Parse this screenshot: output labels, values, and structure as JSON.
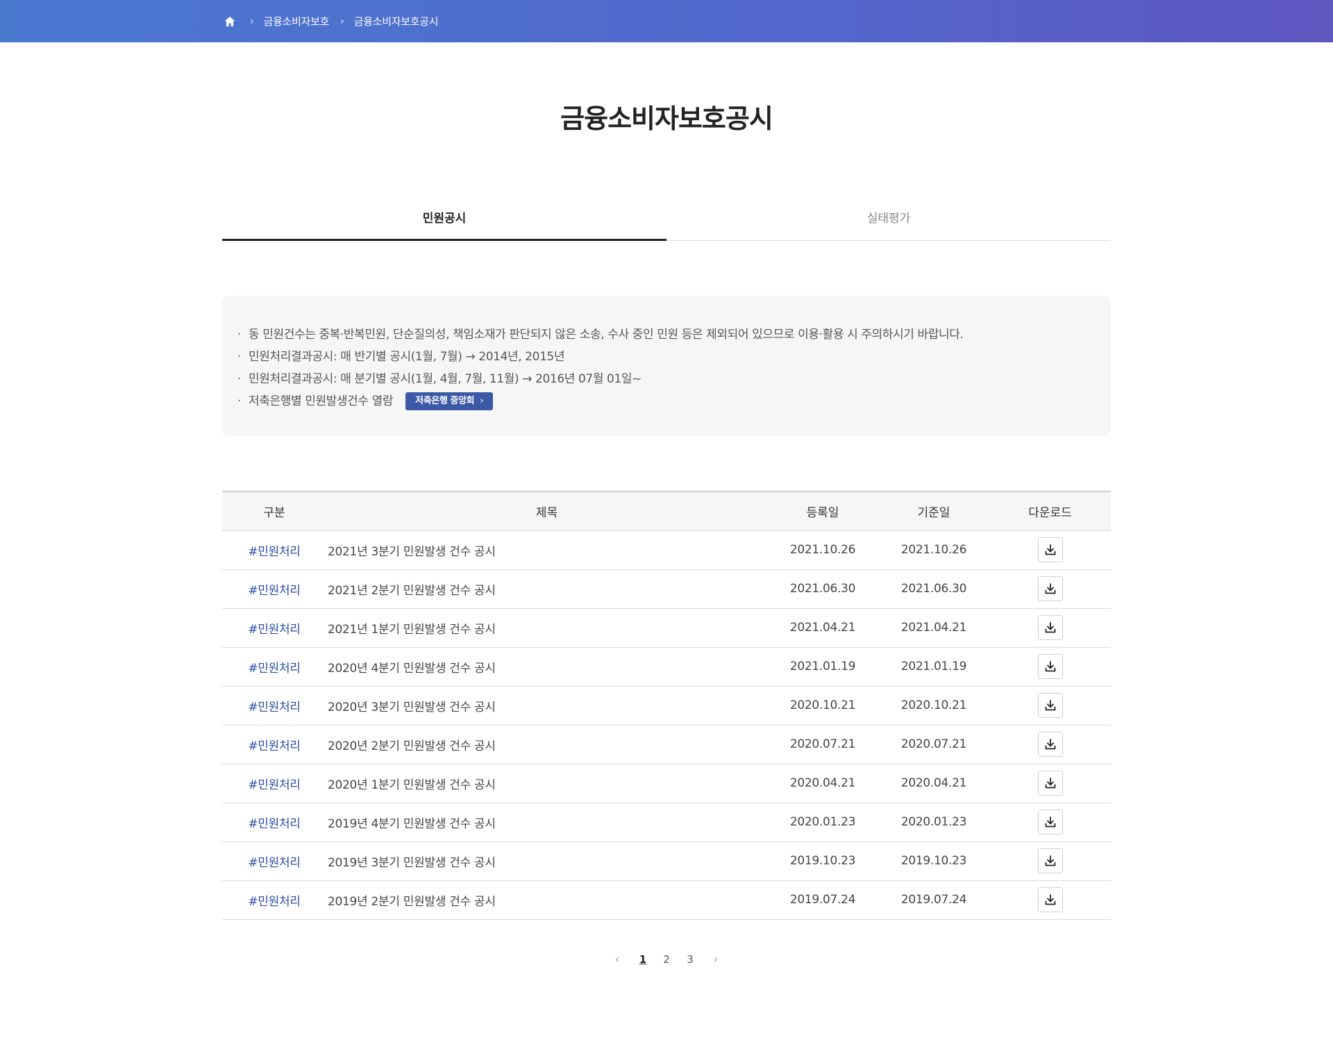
{
  "breadcrumb": {
    "home_icon": "home-icon",
    "items": [
      "금융소비자보호",
      "금융소비자보호공시"
    ]
  },
  "page": {
    "title": "금융소비자보호공시"
  },
  "tabs": [
    {
      "label": "민원공시",
      "active": true
    },
    {
      "label": "실태평가",
      "active": false
    }
  ],
  "notice": {
    "items": [
      "동 민원건수는 중복·반복민원, 단순질의성, 책임소재가 판단되지 않은 소송, 수사 중인 민원 등은 제외되어 있으므로 이용·활용 시 주의하시기 바랍니다.",
      "민원처리결과공시: 매 반기별 공시(1월, 7월) → 2014년, 2015년",
      "민원처리결과공시: 매 분기별 공시(1월, 4월, 7월, 11월) → 2016년 07월 01일~",
      "저축은행별 민원발생건수 열람"
    ],
    "link_button": "저축은행 중앙회"
  },
  "table": {
    "headers": [
      "구분",
      "제목",
      "등록일",
      "기준일",
      "다운로드"
    ],
    "rows": [
      {
        "category": "#민원처리",
        "title": "2021년 3분기 민원발생 건수 공시",
        "registered": "2021.10.26",
        "base": "2021.10.26"
      },
      {
        "category": "#민원처리",
        "title": "2021년 2분기 민원발생 건수 공시",
        "registered": "2021.06.30",
        "base": "2021.06.30"
      },
      {
        "category": "#민원처리",
        "title": "2021년 1분기 민원발생 건수 공시",
        "registered": "2021.04.21",
        "base": "2021.04.21"
      },
      {
        "category": "#민원처리",
        "title": "2020년 4분기 민원발생 건수 공시",
        "registered": "2021.01.19",
        "base": "2021.01.19"
      },
      {
        "category": "#민원처리",
        "title": "2020년 3분기 민원발생 건수 공시",
        "registered": "2020.10.21",
        "base": "2020.10.21"
      },
      {
        "category": "#민원처리",
        "title": "2020년 2분기 민원발생 건수 공시",
        "registered": "2020.07.21",
        "base": "2020.07.21"
      },
      {
        "category": "#민원처리",
        "title": "2020년 1분기 민원발생 건수 공시",
        "registered": "2020.04.21",
        "base": "2020.04.21"
      },
      {
        "category": "#민원처리",
        "title": "2019년 4분기 민원발생 건수 공시",
        "registered": "2020.01.23",
        "base": "2020.01.23"
      },
      {
        "category": "#민원처리",
        "title": "2019년 3분기 민원발생 건수 공시",
        "registered": "2019.10.23",
        "base": "2019.10.23"
      },
      {
        "category": "#민원처리",
        "title": "2019년 2분기 민원발생 건수 공시",
        "registered": "2019.07.24",
        "base": "2019.07.24"
      }
    ]
  },
  "pagination": {
    "pages": [
      "1",
      "2",
      "3"
    ],
    "current": "1"
  },
  "colors": {
    "header_gradient_start": "#4a79d0",
    "header_gradient_end": "#5e57c0",
    "tag": "#2b4fa3",
    "button": "#3c59a7"
  }
}
